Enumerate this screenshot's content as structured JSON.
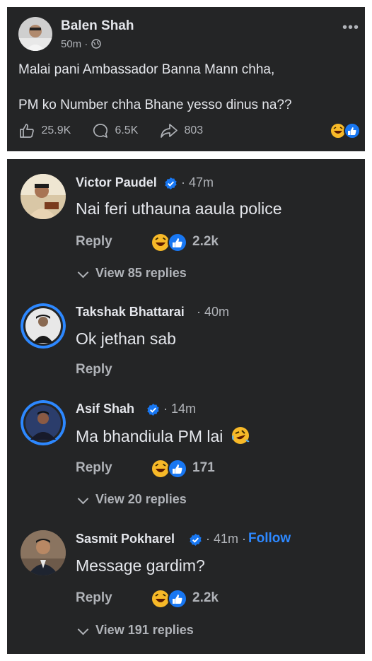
{
  "post": {
    "author": "Balen Shah",
    "time": "50m",
    "privacy_icon": "globe-icon",
    "more_icon": "more-dots-icon",
    "line1": "Malai pani Ambassador Banna Mann chha,",
    "line2": "PM ko Number chha Bhane yesso dinus na??",
    "likes": "25.9K",
    "comments": "6.5K",
    "shares": "803"
  },
  "comments": [
    {
      "name": "Victor Paudel",
      "verified": true,
      "time": "· 47m",
      "text": "Nai feri uthauna aaula police",
      "reply": "Reply",
      "count": "2.2k",
      "view": "View 85 replies"
    },
    {
      "name": "Takshak Bhattarai",
      "verified": false,
      "time": "· 40m",
      "text": "Ok jethan sab",
      "reply": "Reply"
    },
    {
      "name": "Asif Shah",
      "verified": true,
      "time": "· 14m",
      "text": "Ma bhandiula PM lai",
      "reply": "Reply",
      "count": "171",
      "view": "View 20 replies"
    },
    {
      "name": "Sasmit Pokharel",
      "verified": true,
      "time": "· 41m ·",
      "follow": "Follow",
      "text": "Message gardim?",
      "reply": "Reply",
      "count": "2.2k",
      "view": "View 191 replies"
    }
  ],
  "colors": {
    "background": "#242526",
    "text": "#e4e6eb",
    "muted": "#b0b3b8",
    "accent": "#2d88ff"
  }
}
